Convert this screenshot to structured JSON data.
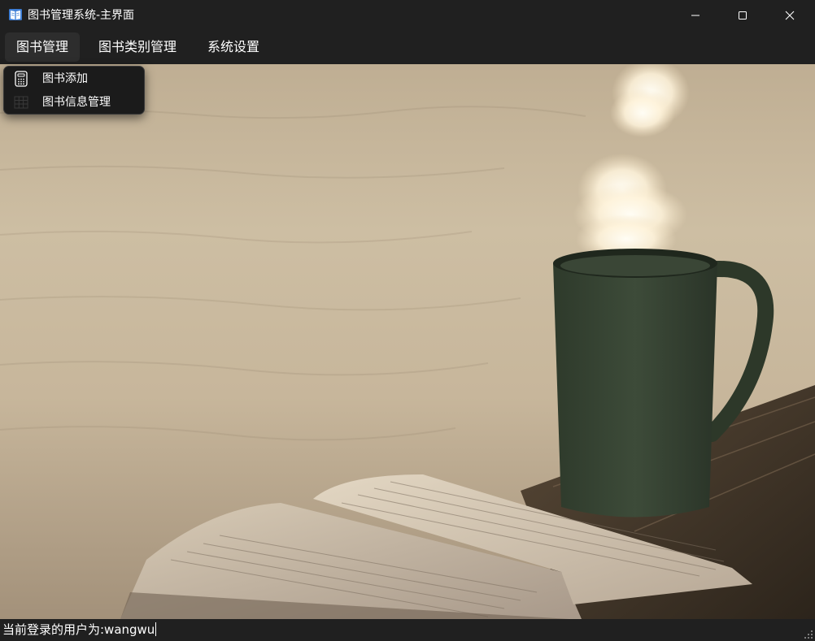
{
  "window": {
    "title": "图书管理系统-主界面",
    "controls": {
      "minimize": "minimize-icon",
      "maximize": "maximize-icon",
      "close": "close-icon"
    }
  },
  "menubar": {
    "items": [
      {
        "label": "图书管理",
        "active": true
      },
      {
        "label": "图书类别管理"
      },
      {
        "label": "系统设置"
      }
    ]
  },
  "dropdown": {
    "items": [
      {
        "label": "图书添加",
        "icon": "calculator-icon"
      },
      {
        "label": "图书信息管理",
        "icon": "grid-icon"
      }
    ]
  },
  "statusbar": {
    "text": "当前登录的用户为:wangwu"
  },
  "colors": {
    "chrome": "#202020",
    "text": "#ffffff",
    "mug": "#33402f",
    "photo_tone": "#c7b69b"
  }
}
